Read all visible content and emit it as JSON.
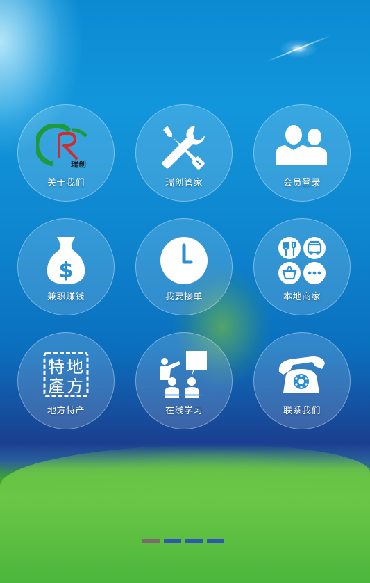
{
  "menu": {
    "items": [
      {
        "id": "about",
        "label": "关于我们",
        "icon": "ruichuang-logo-icon",
        "logo_text": "瑞创"
      },
      {
        "id": "manager",
        "label": "瑞创管家",
        "icon": "tools-icon"
      },
      {
        "id": "login",
        "label": "会员登录",
        "icon": "users-icon"
      },
      {
        "id": "earn",
        "label": "兼职赚钱",
        "icon": "money-bag-icon"
      },
      {
        "id": "orders",
        "label": "我要接单",
        "icon": "clock-icon"
      },
      {
        "id": "merchants",
        "label": "本地商家",
        "icon": "merchants-icon"
      },
      {
        "id": "specialty",
        "label": "地方特产",
        "icon": "specialty-stamp-icon",
        "stamp_chars": [
          "特",
          "地",
          "產",
          "方"
        ]
      },
      {
        "id": "learn",
        "label": "在线学习",
        "icon": "classroom-icon"
      },
      {
        "id": "contact",
        "label": "联系我们",
        "icon": "telephone-icon"
      }
    ]
  },
  "carousel": {
    "count": 4,
    "active_index": 0
  },
  "colors": {
    "sky": "#1296db",
    "grass": "#58bf3c",
    "dot": "#2f56b2",
    "dot_active": "#7c6a6e",
    "logo_green": "#1f9a3a",
    "logo_red": "#d42a2a"
  }
}
